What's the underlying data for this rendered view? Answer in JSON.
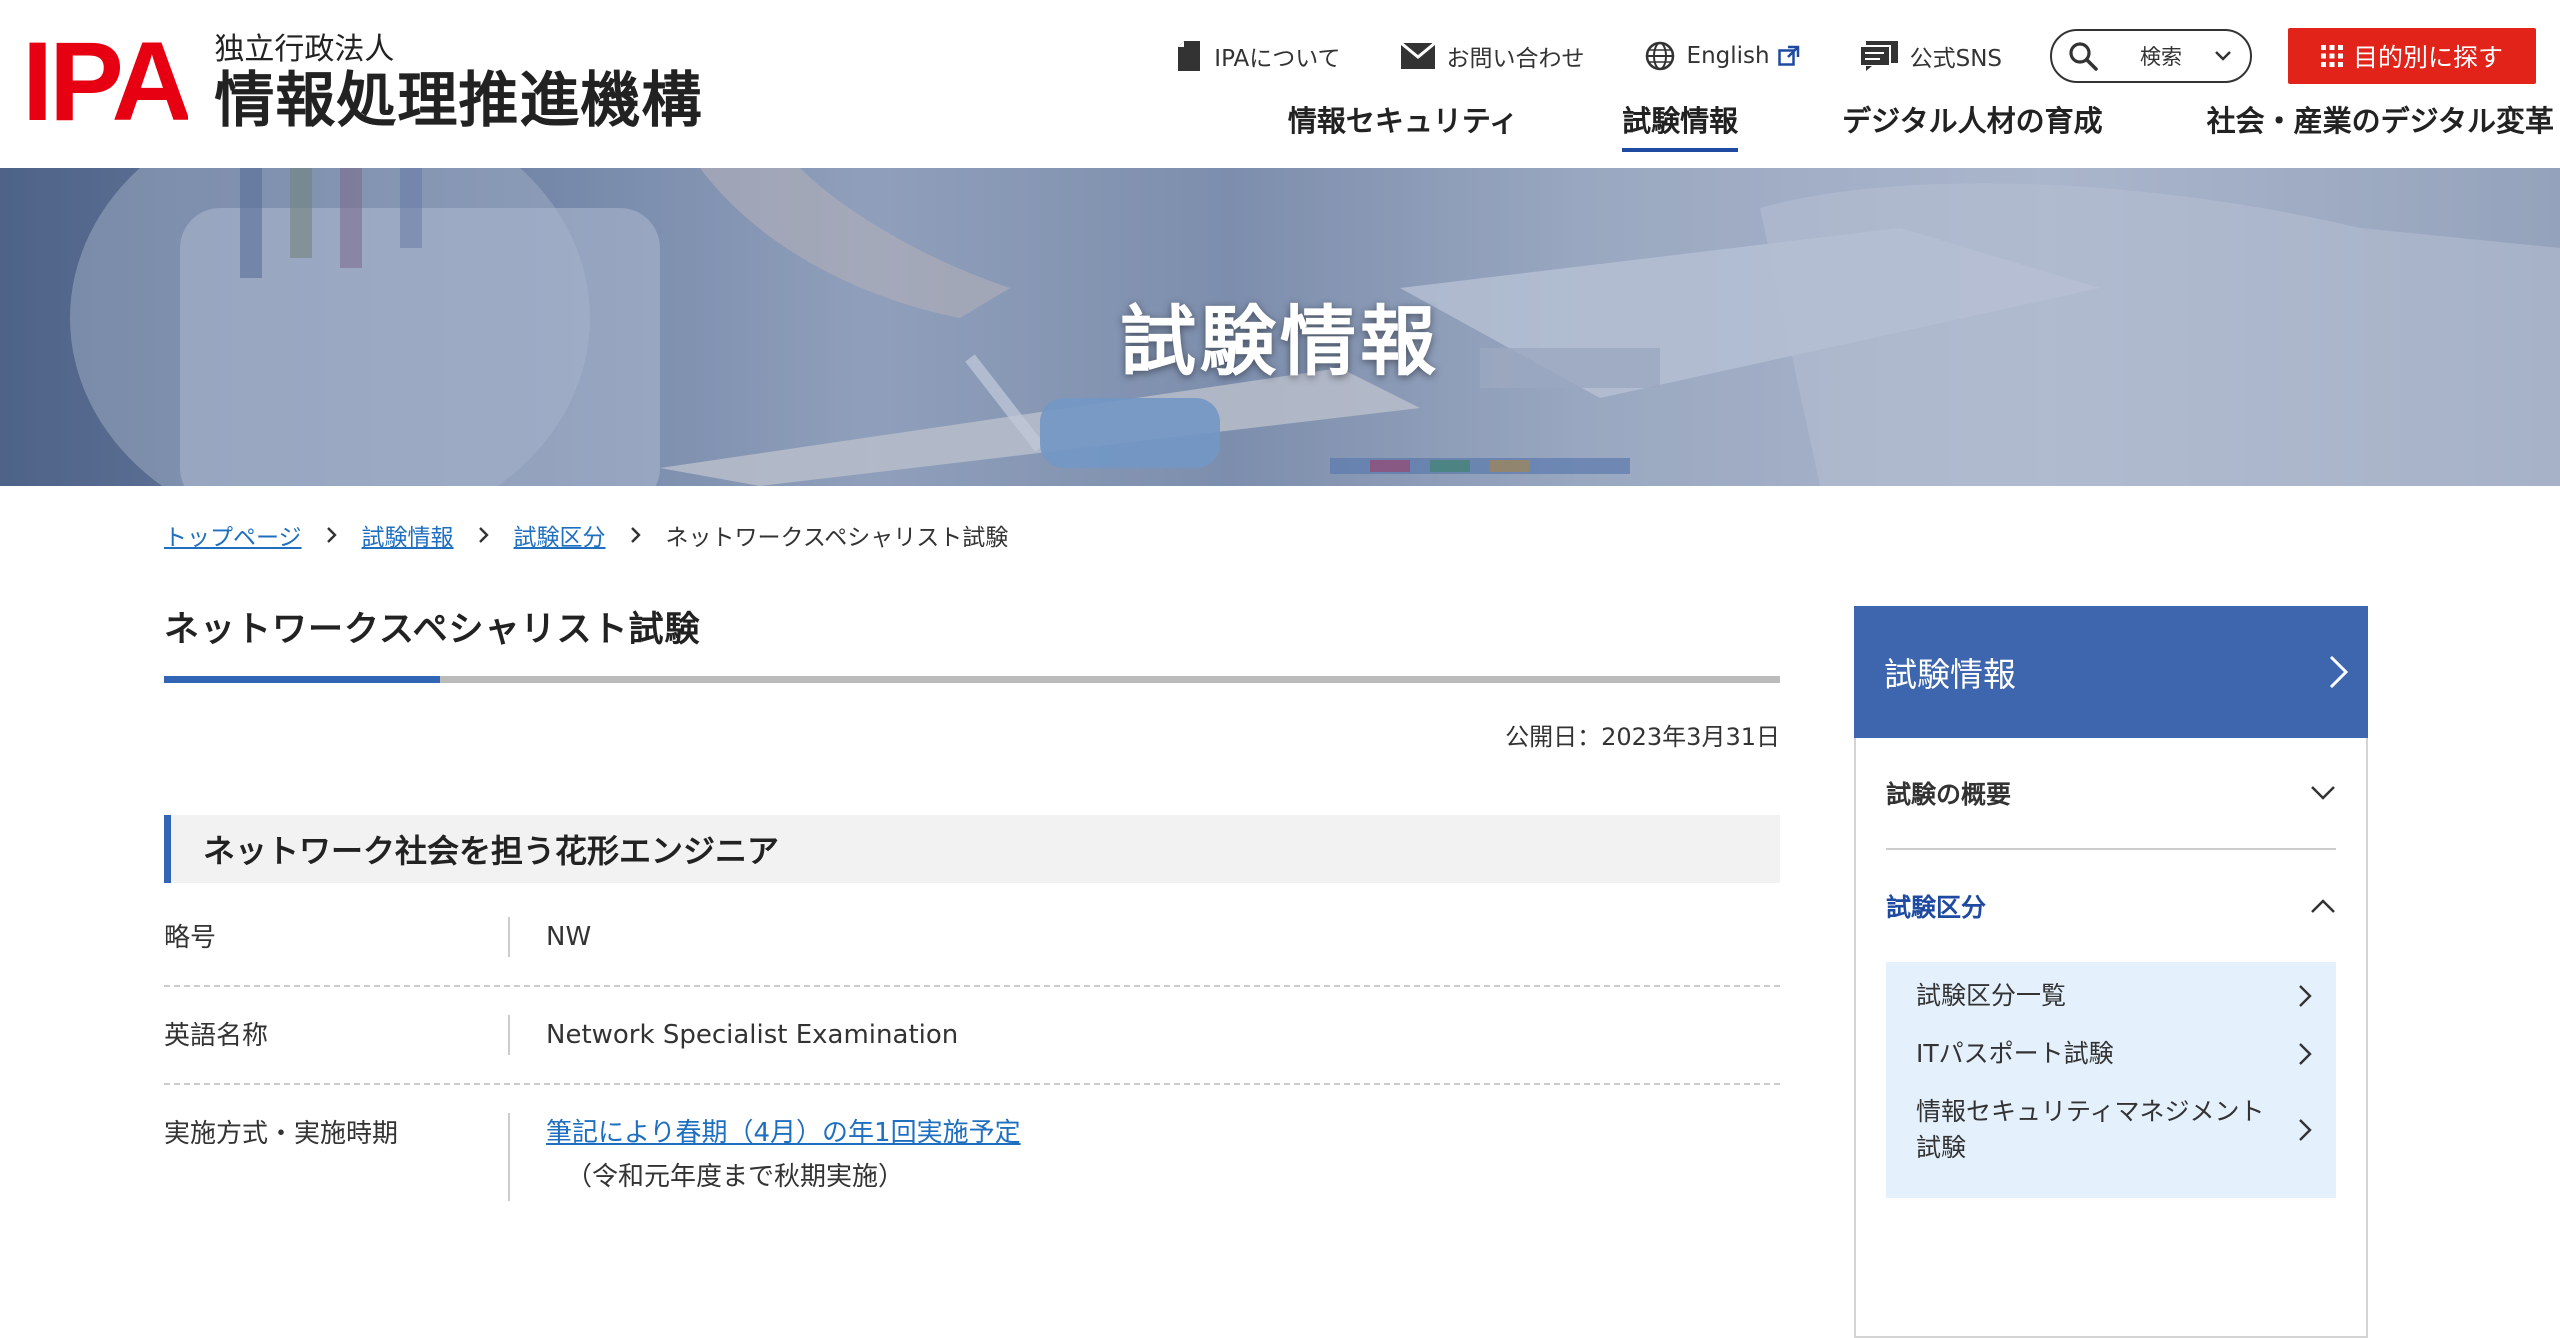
{
  "header": {
    "logo_mark": "IPA",
    "logo_sub": "独立行政法人",
    "logo_main": "情報処理推進機構",
    "util": [
      {
        "label": "IPAについて",
        "icon": "document-icon"
      },
      {
        "label": "お問い合わせ",
        "icon": "mail-icon"
      },
      {
        "label": "English",
        "icon": "globe-icon"
      },
      {
        "label": "公式SNS",
        "icon": "sns-icon"
      }
    ],
    "search_label": "検索",
    "purpose_label": "目的別に探す",
    "gnav": [
      "情報セキュリティ",
      "試験情報",
      "デジタル人材の育成",
      "社会・産業のデジタル変革"
    ]
  },
  "hero": {
    "title": "試験情報"
  },
  "breadcrumb": {
    "items": [
      "トップページ",
      "試験情報",
      "試験区分"
    ],
    "current": "ネットワークスペシャリスト試験"
  },
  "main": {
    "title": "ネットワークスペシャリスト試験",
    "publish_date": "公開日：2023年3月31日",
    "section_heading": "ネットワーク社会を担う花形エンジニア",
    "rows": [
      {
        "label": "略号",
        "value": "NW"
      },
      {
        "label": "英語名称",
        "value": "Network Specialist Examination"
      },
      {
        "label": "実施方式・実施時期",
        "link": "筆記により春期（4月）の年1回実施予定",
        "note": "（令和元年度まで秋期実施）"
      }
    ]
  },
  "sidebar": {
    "title": "試験情報",
    "sections": [
      "試験の概要",
      "試験区分"
    ],
    "sub_items": [
      "試験区分一覧",
      "ITパスポート試験",
      "情報セキュリティマネジメント試験"
    ]
  },
  "colors": {
    "brand_red": "#e60012",
    "button_red": "#e2231a",
    "accent_blue": "#3365b5",
    "link_blue": "#1f6fc1",
    "sidebar_blue": "#3d66ae"
  }
}
